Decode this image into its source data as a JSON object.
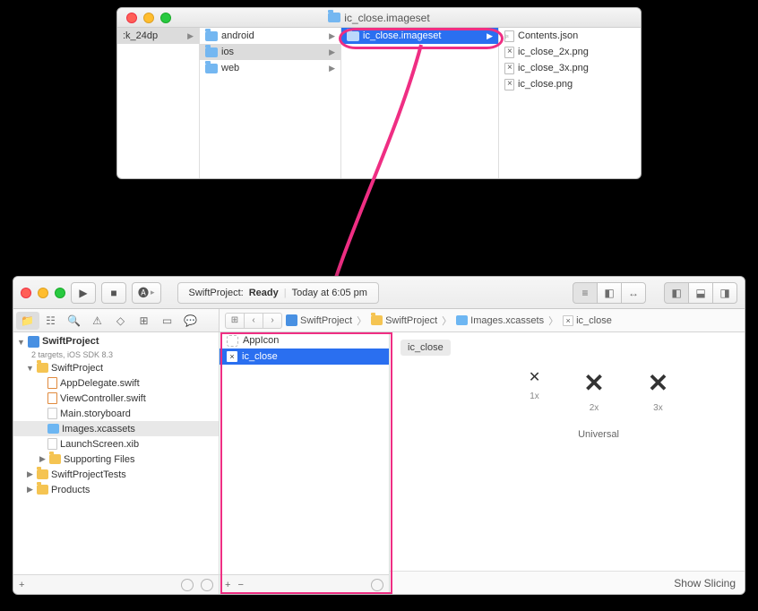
{
  "finder": {
    "title": "ic_close.imageset",
    "col0": {
      "item": ":k_24dp"
    },
    "col1": {
      "items": [
        {
          "name": "android",
          "selected": false
        },
        {
          "name": "ios",
          "selected": true
        },
        {
          "name": "web",
          "selected": false
        }
      ]
    },
    "col2": {
      "items": [
        {
          "name": "ic_close.imageset",
          "selected": true
        }
      ]
    },
    "col3": {
      "items": [
        {
          "name": "Contents.json",
          "type": "json"
        },
        {
          "name": "ic_close_2x.png",
          "type": "png"
        },
        {
          "name": "ic_close_3x.png",
          "type": "png"
        },
        {
          "name": "ic_close.png",
          "type": "png"
        }
      ]
    }
  },
  "xcode": {
    "status": {
      "scheme": "SwiftProject:",
      "state": "Ready",
      "sep": "|",
      "time": "Today at 6:05 pm"
    },
    "nav": {
      "project": "SwiftProject",
      "subtitle": "2 targets, iOS SDK 8.3",
      "groups": [
        {
          "name": "SwiftProject",
          "children": [
            {
              "name": "AppDelegate.swift",
              "kind": "swift"
            },
            {
              "name": "ViewController.swift",
              "kind": "swift"
            },
            {
              "name": "Main.storyboard",
              "kind": "sb"
            },
            {
              "name": "Images.xcassets",
              "kind": "assets",
              "selected": true
            },
            {
              "name": "LaunchScreen.xib",
              "kind": "sb"
            },
            {
              "name": "Supporting Files",
              "kind": "group"
            }
          ]
        },
        {
          "name": "SwiftProjectTests",
          "children": []
        },
        {
          "name": "Products",
          "children": []
        }
      ]
    },
    "assets": {
      "items": [
        {
          "name": "AppIcon",
          "selected": false
        },
        {
          "name": "ic_close",
          "selected": true
        }
      ]
    },
    "jumpbar": {
      "crumbs": [
        "SwiftProject",
        "SwiftProject",
        "Images.xcassets",
        "ic_close"
      ]
    },
    "detail": {
      "header": "ic_close",
      "scales": [
        "1x",
        "2x",
        "3x"
      ],
      "universal": "Universal",
      "show_slicing": "Show Slicing"
    },
    "footer_plus": "+",
    "footer_minus": "−"
  }
}
